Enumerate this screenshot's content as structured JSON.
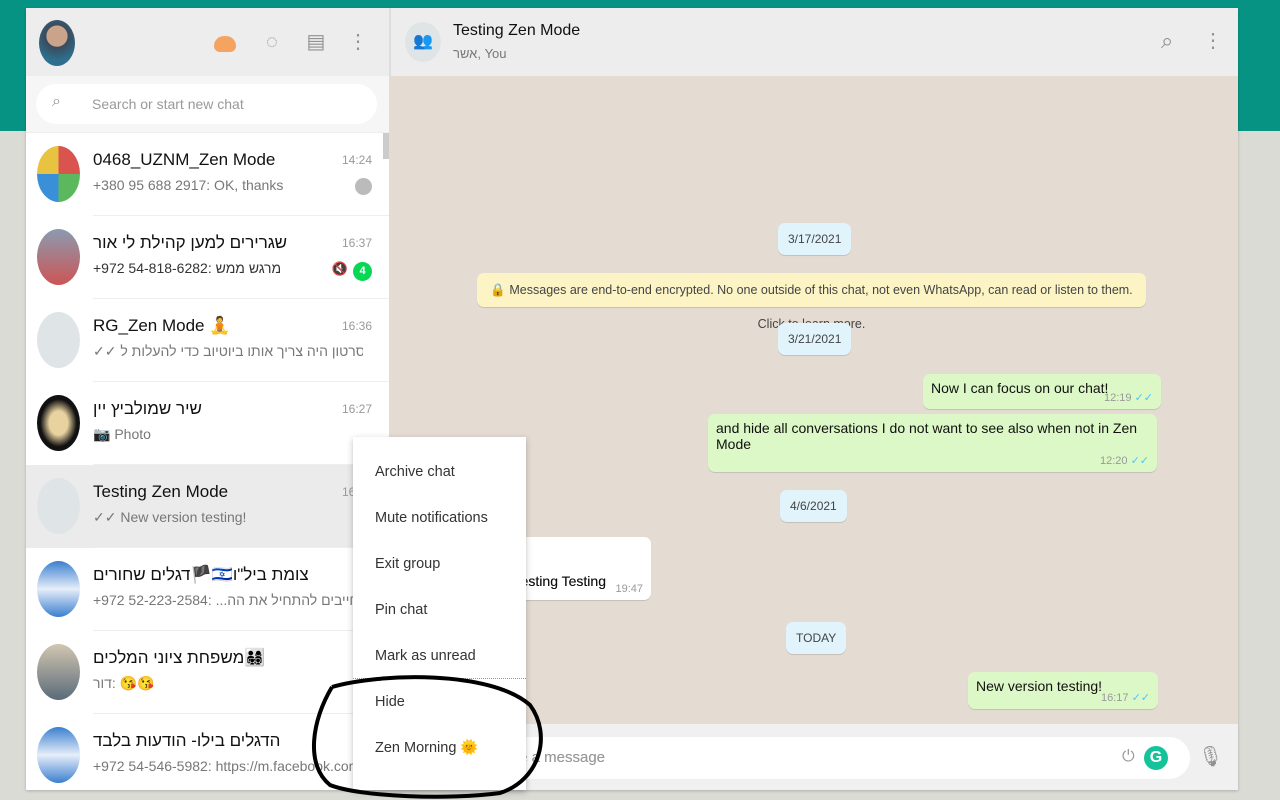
{
  "sidebar": {
    "search_placeholder": "Search or start new chat",
    "icons": [
      "status-icon",
      "refresh-icon",
      "new-chat-icon",
      "menu-icon"
    ],
    "chats": [
      {
        "name": "0468_UZNM_Zen Mode",
        "time": "14:24",
        "preview": "+380 95 688 2917: OK, thanks",
        "pinned": true
      },
      {
        "name": "שגרירים למען קהילת לי אור",
        "time": "16:37",
        "preview": "+972 54-818-6282: מרגש ממש",
        "muted": true,
        "unread": "4"
      },
      {
        "name": "RG_Zen Mode 🧘",
        "time": "16:36",
        "preview": "✓✓ אותו סרטון היה צריך אותו ביוטיוב כדי להעלות ל..."
      },
      {
        "name": "שיר שמולביץ יין",
        "time": "16:27",
        "preview": "📷 Photo"
      },
      {
        "name": "Testing Zen Mode",
        "time": "16:17",
        "preview": "✓✓ New version testing!",
        "selected": true
      },
      {
        "name": "דגלים שחורים🏴🇮🇱צומת ביל\"ו",
        "time": "16",
        "preview": "+972 52-223-2584: ...ברים,חייבים להתחיל את הה"
      },
      {
        "name": "משפחת ציוני המלכים👨‍👩‍👧‍👦",
        "time": "15",
        "preview": "דור: 😘😘"
      },
      {
        "name": "הדגלים בילו- הודעות בלבד",
        "time": "15",
        "preview": "+972 54-546-5982: https://m.facebook.com/st..."
      }
    ]
  },
  "chat": {
    "title": "Testing Zen Mode",
    "subtitle": "אשר, You",
    "dates": [
      "3/17/2021",
      "3/21/2021",
      "4/6/2021",
      "TODAY"
    ],
    "encryption_notice": "🔒 Messages are end-to-end encrypted. No one outside of this chat, not even WhatsApp, can read or listen to them. Click to learn more.",
    "messages": [
      {
        "text": "Now I can focus on our chat!",
        "time": "12:19",
        "dir": "out"
      },
      {
        "text": "and hide all conversations I do not want to see also when not in Zen Mode",
        "time": "12:20",
        "dir": "out"
      },
      {
        "text": "Testing Testing",
        "visible_text": "sting Testing",
        "time": "19:47",
        "dir": "in"
      },
      {
        "text": "New version testing!",
        "time": "16:17",
        "dir": "out"
      }
    ],
    "input_placeholder": "Type a message",
    "input_visible": "a message"
  },
  "context_menu": {
    "items": [
      "Archive chat",
      "Mute notifications",
      "Exit group",
      "Pin chat",
      "Mark as unread",
      "Hide",
      "Zen Morning 🌞"
    ]
  },
  "colors": {
    "accent": "#079383",
    "out_bubble": "#dcf8c6",
    "unread_badge": "#06d755",
    "read_tick": "#4fc3f7"
  }
}
